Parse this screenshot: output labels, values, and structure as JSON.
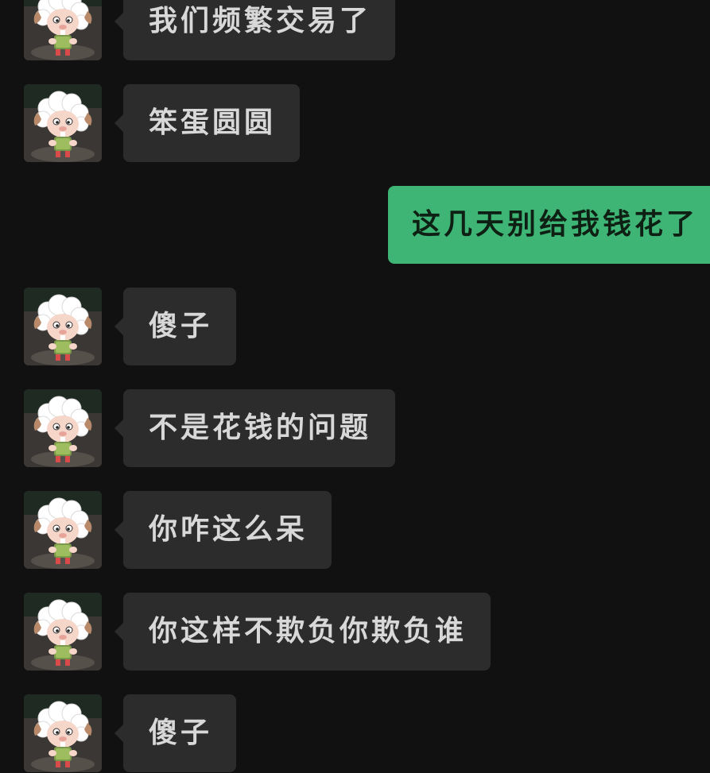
{
  "chat": {
    "messages": [
      {
        "sender": "contact",
        "text": "我们频繁交易了"
      },
      {
        "sender": "contact",
        "text": "笨蛋圆圆"
      },
      {
        "sender": "me",
        "text": "这几天别给我钱花了"
      },
      {
        "sender": "contact",
        "text": "傻子"
      },
      {
        "sender": "contact",
        "text": "不是花钱的问题"
      },
      {
        "sender": "contact",
        "text": "你咋这么呆"
      },
      {
        "sender": "contact",
        "text": "你这样不欺负你欺负谁"
      },
      {
        "sender": "contact",
        "text": "傻子"
      }
    ]
  },
  "colors": {
    "background": "#111111",
    "incoming_bubble": "#2c2c2c",
    "outgoing_bubble": "#3eb575"
  },
  "icons": {
    "contact_avatar": "sheep-avatar-icon"
  }
}
